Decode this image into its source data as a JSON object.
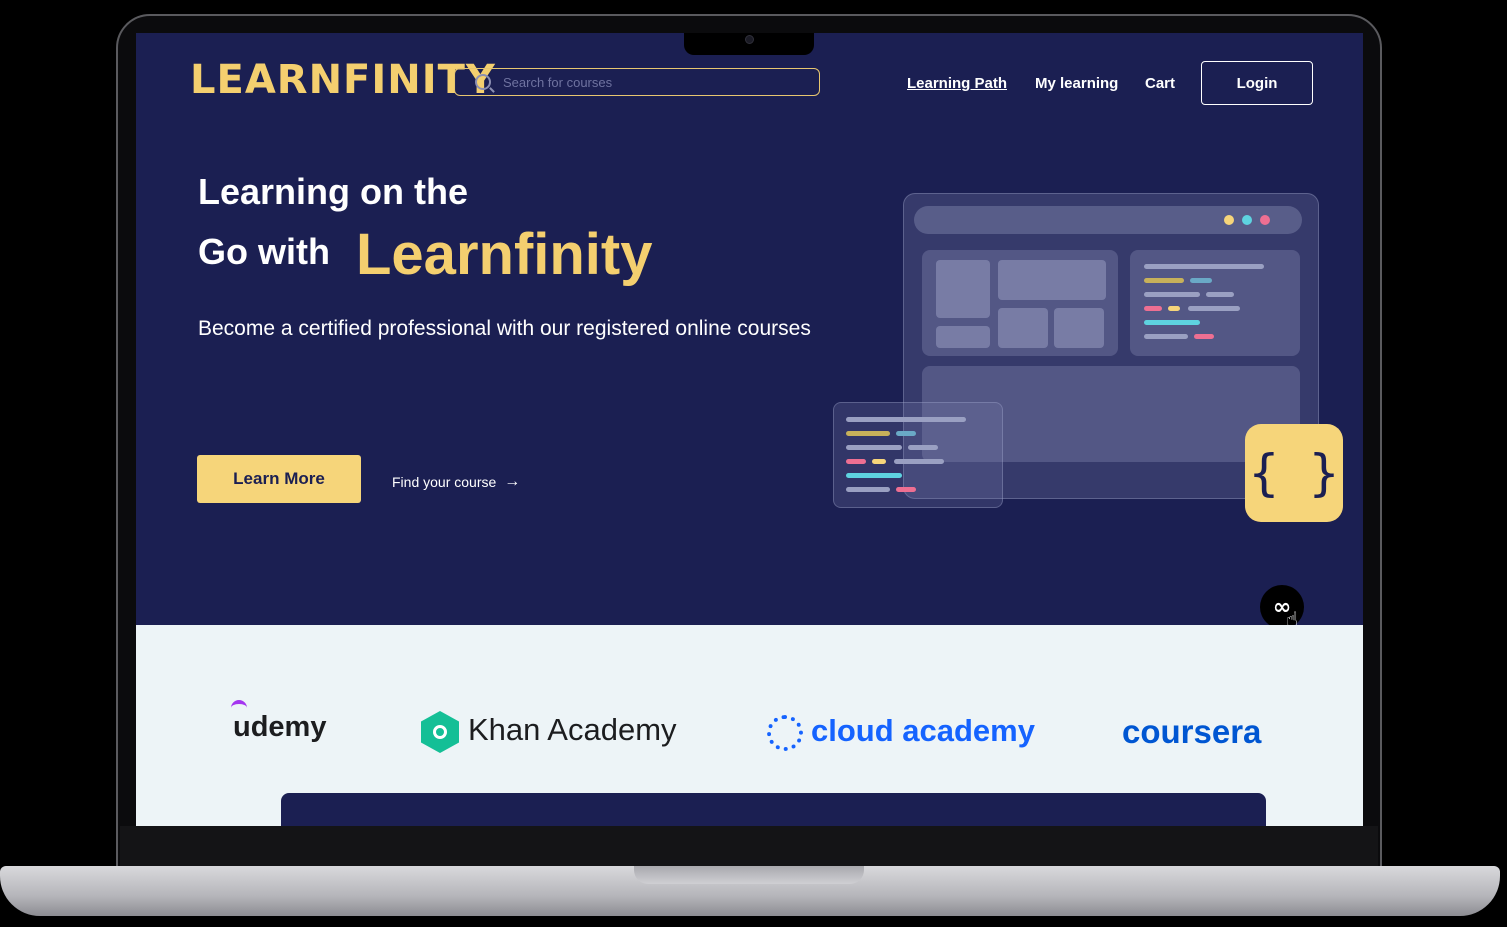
{
  "header": {
    "logo": "LEARNFINITY",
    "search_placeholder": "Search for courses",
    "nav": [
      "Learning Path",
      "My learning",
      "Cart"
    ],
    "login_label": "Login"
  },
  "hero": {
    "title_line1": "Learning on the",
    "title_line2": "Go with",
    "title_brand": "Learnfinity",
    "subtitle": "Become a certified professional with our registered online courses",
    "learn_more_label": "Learn More",
    "find_course_label": "Find your course"
  },
  "illustration": {
    "braces_glyph": "{ }",
    "infinity_glyph": "∞"
  },
  "partners": [
    "udemy",
    "Khan Academy",
    "cloud academy",
    "coursera"
  ],
  "colors": {
    "navy": "#1b1f52",
    "accent": "#f4cf6f",
    "button": "#f6d57a",
    "partners_bg": "#edf4f7",
    "udemy": "#a435f0",
    "khan": "#14bf96",
    "cloud": "#1563ff",
    "coursera": "#0056d2"
  }
}
